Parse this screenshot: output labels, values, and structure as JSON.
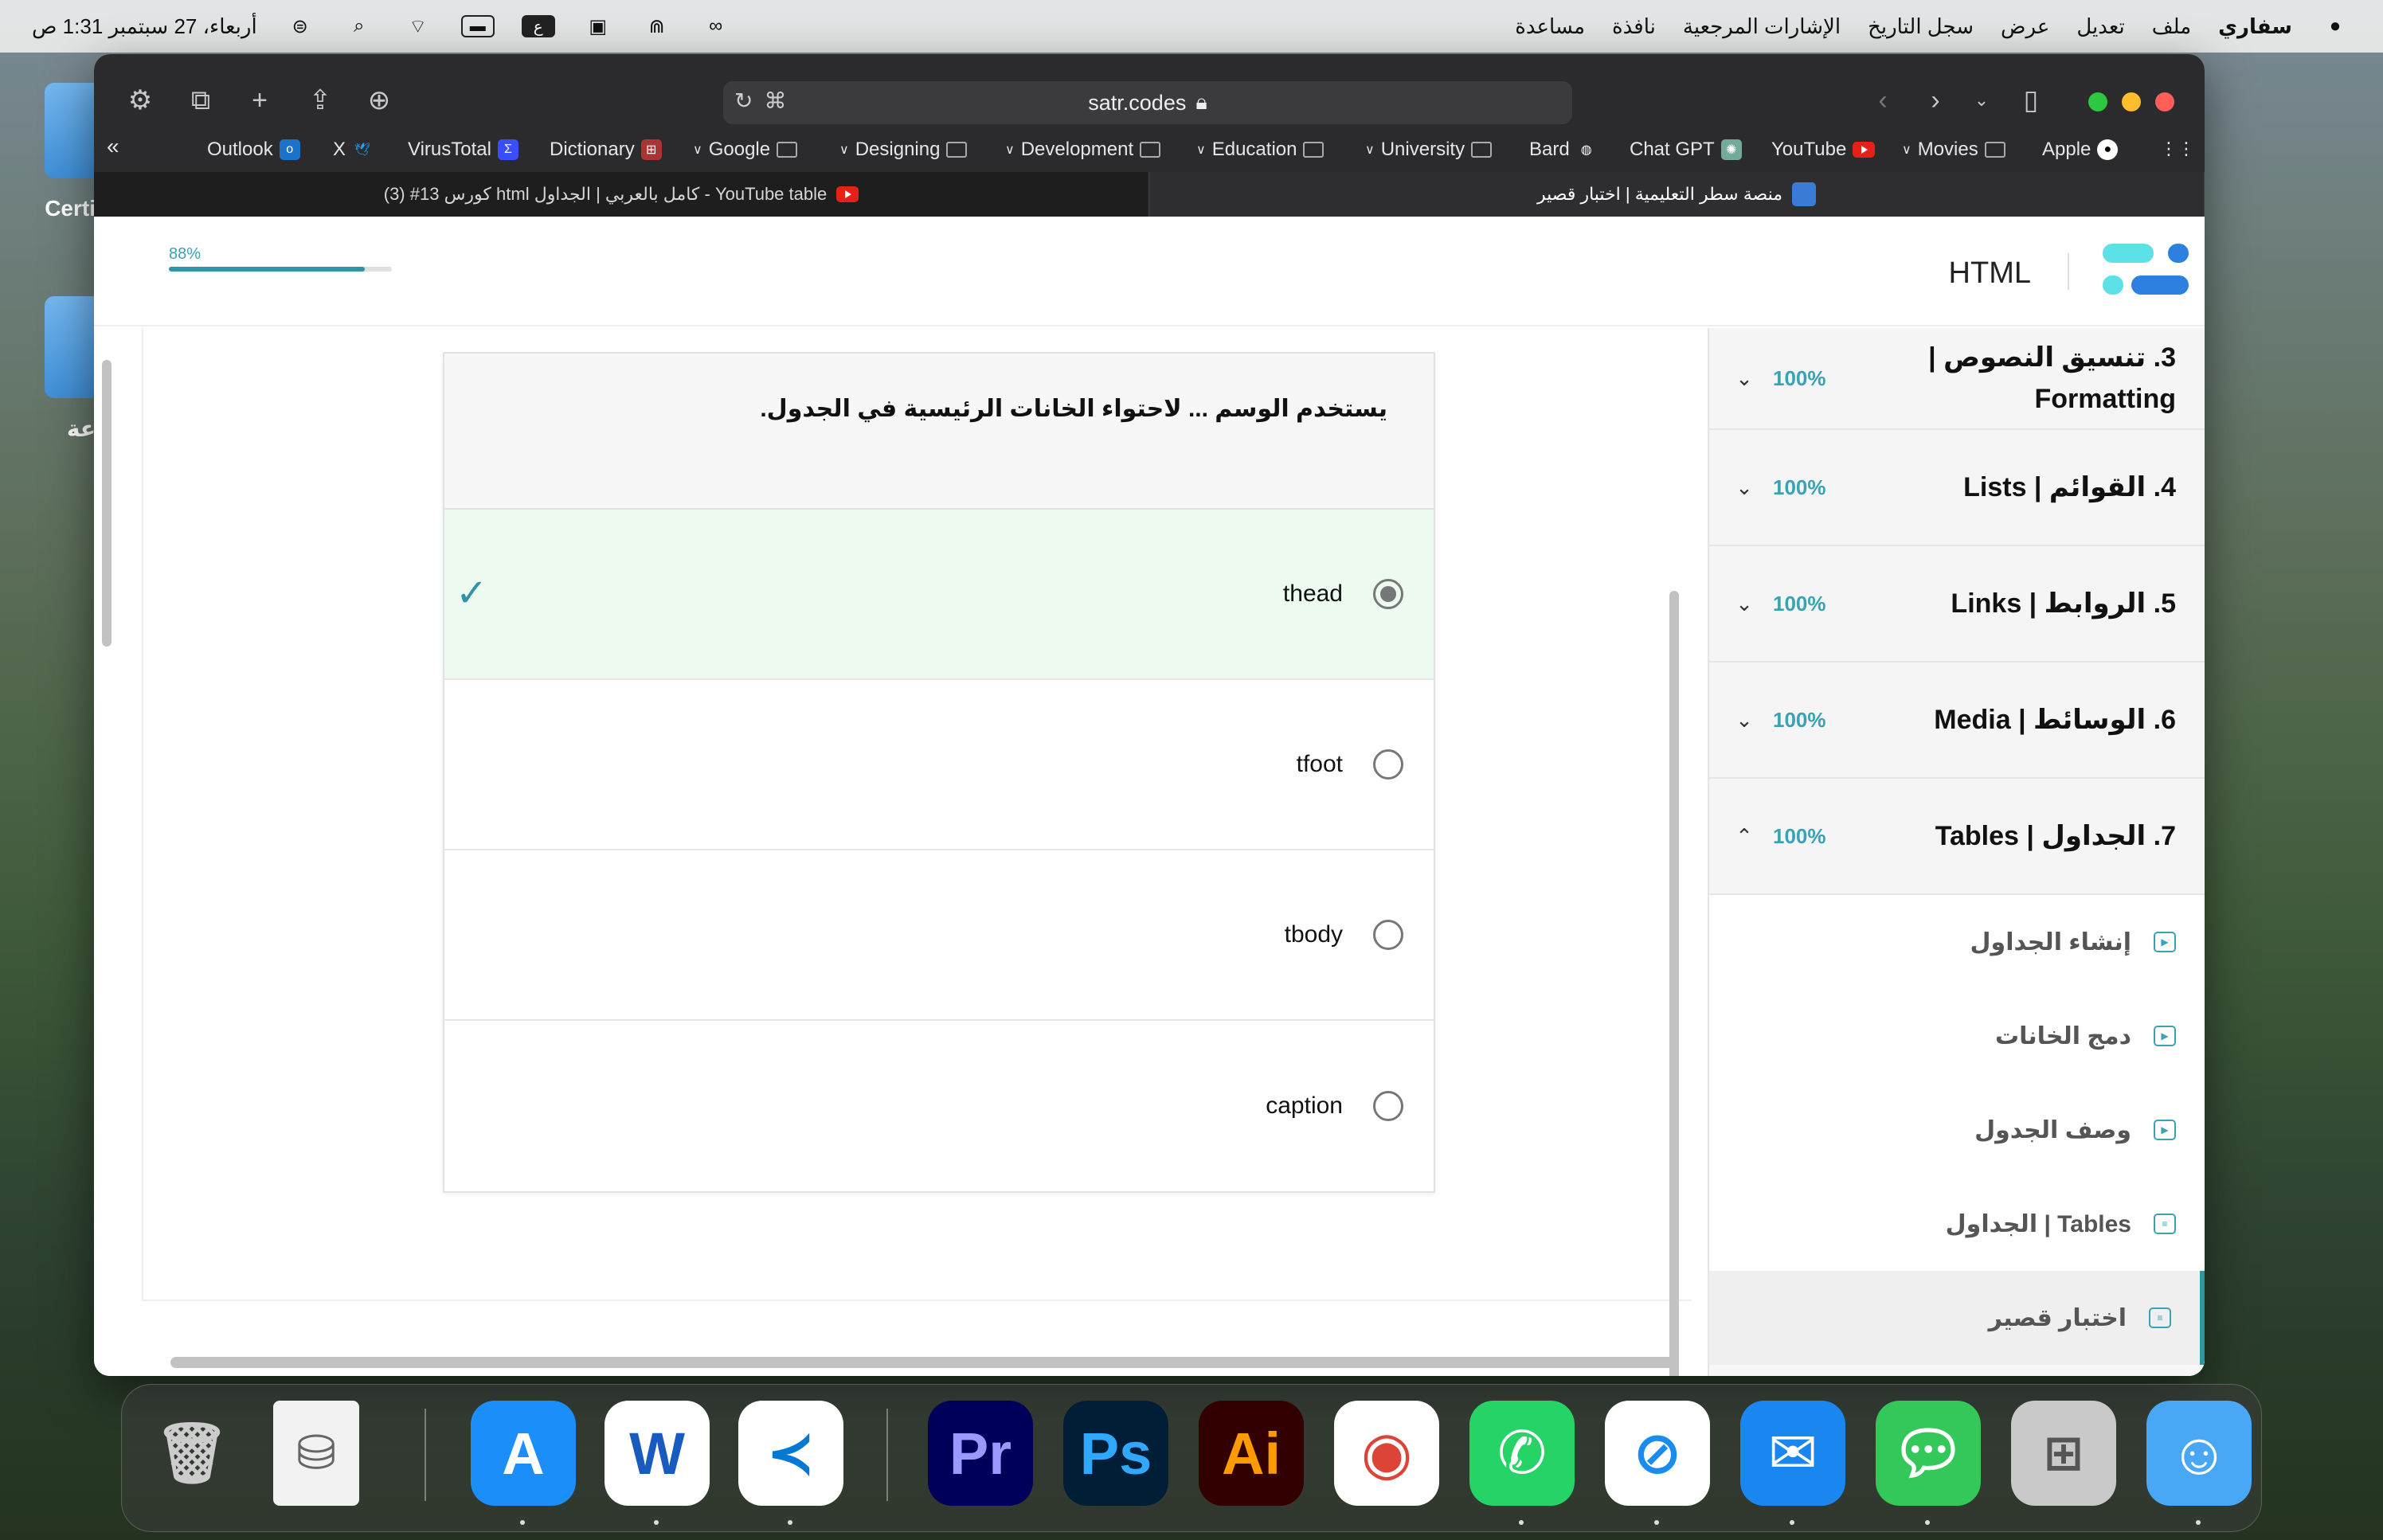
{
  "menubar": {
    "app_name": "سفاري",
    "menus": [
      "ملف",
      "تعديل",
      "عرض",
      "سجل التاريخ",
      "الإشارات المرجعية",
      "نافذة",
      "مساعدة"
    ],
    "clock": "أربعاء، 27 سبتمبر 1:31 ص",
    "input_indicator": "ع"
  },
  "desktop": {
    "items": [
      "Certi",
      "عة"
    ]
  },
  "browser": {
    "url": "satr.codes",
    "bookmarks": [
      "Outlook",
      "X",
      "VirusTotal",
      "Dictionary",
      "Google",
      "Designing",
      "Development",
      "Education",
      "University",
      "Bard",
      "Chat GPT",
      "YouTube",
      "Movies",
      "Apple"
    ],
    "tabs": [
      {
        "title": "(3) #13 كورس html كامل بالعربي | الجداول - YouTube table"
      },
      {
        "title": "منصة سطر التعليمية | اختبار قصير"
      }
    ]
  },
  "header": {
    "course_title": "HTML",
    "progress_label": "88%",
    "progress_value": 0.88
  },
  "sidebar": {
    "sections": [
      {
        "title": "3. تنسيق النصوص | Formatting",
        "percent": "100%",
        "chevron": "down"
      },
      {
        "title": "4. القوائم | Lists",
        "percent": "100%",
        "chevron": "down"
      },
      {
        "title": "5. الروابط | Links",
        "percent": "100%",
        "chevron": "down"
      },
      {
        "title": "6. الوسائط | Media",
        "percent": "100%",
        "chevron": "down"
      },
      {
        "title": "7. الجداول | Tables",
        "percent": "100%",
        "chevron": "up"
      }
    ],
    "lessons": [
      {
        "label": "إنشاء الجداول",
        "icon": "video-icon"
      },
      {
        "label": "دمج الخانات",
        "icon": "video-icon"
      },
      {
        "label": "وصف الجدول",
        "icon": "video-icon"
      },
      {
        "label": "الجداول | Tables",
        "icon": "article-icon"
      },
      {
        "label": "اختبار قصير",
        "icon": "quiz-icon",
        "active": true
      }
    ]
  },
  "quiz": {
    "question": "يستخدم الوسم ... لاحتواء الخانات الرئيسية في الجدول.",
    "options": [
      {
        "label": "thead",
        "selected": true,
        "correct": true
      },
      {
        "label": "tfoot",
        "selected": false
      },
      {
        "label": "tbody",
        "selected": false
      },
      {
        "label": "caption",
        "selected": false
      }
    ]
  },
  "dock": {
    "apps": [
      "Trash",
      "Disk Utility",
      "App Store",
      "Word",
      "VS Code",
      "Premiere Pro",
      "Photoshop",
      "Illustrator",
      "Chrome",
      "WhatsApp",
      "Safari",
      "Mail",
      "Messages",
      "Launchpad",
      "Finder"
    ],
    "labels": {
      "word": "W",
      "premiere": "Pr",
      "photoshop": "Ps",
      "illustrator": "Ai"
    }
  },
  "colors": {
    "accent": "#3aa3b3",
    "correct_bg": "#ecfaef",
    "logo_light": "#5de0e6",
    "logo_dark": "#2d7fe0"
  }
}
